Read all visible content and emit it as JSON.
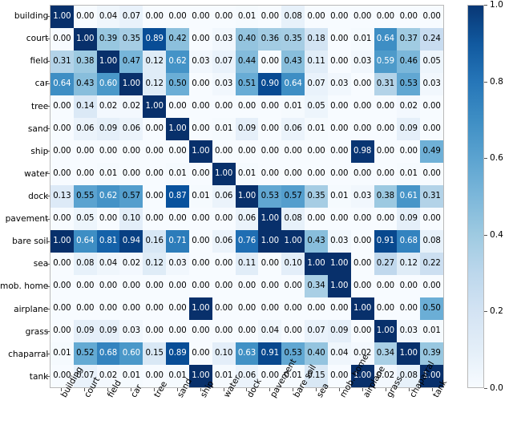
{
  "chart_data": {
    "type": "heatmap",
    "title": "",
    "xlabel": "",
    "ylabel": "",
    "colormap": "Blues",
    "colorbar": {
      "vmin": 0.0,
      "vmax": 1.0,
      "ticks": [
        0.0,
        0.2,
        0.4,
        0.6,
        0.8,
        1.0
      ],
      "tick_labels": [
        "0.0",
        "0.2",
        "0.4",
        "0.6",
        "0.8",
        "1.0"
      ],
      "position": "right"
    },
    "grid": false,
    "value_format": "0.00",
    "categories": [
      "building",
      "court",
      "field",
      "car",
      "tree",
      "sand",
      "ship",
      "water",
      "dock",
      "pavement",
      "bare soil",
      "sea",
      "mob. home",
      "airplane",
      "grass",
      "chaparral",
      "tank"
    ],
    "x_tick_labels": [
      "building",
      "court",
      "field",
      "car",
      "tree",
      "sand",
      "ship",
      "water",
      "dock",
      "pavement",
      "bare soil",
      "sea",
      "mob. home",
      "airplane",
      "grass",
      "chaparral",
      "tank"
    ],
    "y_tick_labels": [
      "building",
      "court",
      "field",
      "car",
      "tree",
      "sand",
      "ship",
      "water",
      "dock",
      "pavement",
      "bare soil",
      "sea",
      "mob. home",
      "airplane",
      "grass",
      "chaparral",
      "tank"
    ],
    "rows": [
      {
        "label": "building",
        "values": [
          1.0,
          0.0,
          0.04,
          0.07,
          0.0,
          0.0,
          0.0,
          0.0,
          0.01,
          0.0,
          0.08,
          0.0,
          0.0,
          0.0,
          0.0,
          0.0,
          0.0
        ]
      },
      {
        "label": "court",
        "values": [
          0.0,
          1.0,
          0.39,
          0.35,
          0.89,
          0.42,
          0.0,
          0.03,
          0.4,
          0.36,
          0.35,
          0.18,
          0.0,
          0.01,
          0.64,
          0.37,
          0.24
        ]
      },
      {
        "label": "field",
        "values": [
          0.31,
          0.38,
          1.0,
          0.47,
          0.12,
          0.62,
          0.03,
          0.07,
          0.44,
          0.0,
          0.43,
          0.11,
          0.0,
          0.03,
          0.59,
          0.46,
          0.05
        ]
      },
      {
        "label": "car",
        "values": [
          0.64,
          0.43,
          0.6,
          1.0,
          0.12,
          0.5,
          0.0,
          0.03,
          0.51,
          0.9,
          0.64,
          0.07,
          0.03,
          0.0,
          0.31,
          0.53,
          0.03
        ]
      },
      {
        "label": "tree",
        "values": [
          0.0,
          0.14,
          0.02,
          0.02,
          1.0,
          0.0,
          0.0,
          0.0,
          0.0,
          0.0,
          0.01,
          0.05,
          0.0,
          0.0,
          0.0,
          0.02,
          0.0
        ]
      },
      {
        "label": "sand",
        "values": [
          0.0,
          0.06,
          0.09,
          0.06,
          0.0,
          1.0,
          0.0,
          0.01,
          0.09,
          0.0,
          0.06,
          0.01,
          0.0,
          0.0,
          0.0,
          0.09,
          0.0
        ]
      },
      {
        "label": "ship",
        "values": [
          0.0,
          0.0,
          0.0,
          0.0,
          0.0,
          0.0,
          1.0,
          0.0,
          0.0,
          0.0,
          0.0,
          0.0,
          0.0,
          0.98,
          0.0,
          0.0,
          0.49
        ]
      },
      {
        "label": "water",
        "values": [
          0.0,
          0.0,
          0.01,
          0.0,
          0.0,
          0.01,
          0.0,
          1.0,
          0.01,
          0.0,
          0.0,
          0.0,
          0.0,
          0.0,
          0.0,
          0.01,
          0.0
        ]
      },
      {
        "label": "dock",
        "values": [
          0.13,
          0.55,
          0.62,
          0.57,
          0.0,
          0.87,
          0.01,
          0.06,
          1.0,
          0.53,
          0.57,
          0.35,
          0.01,
          0.03,
          0.38,
          0.61,
          0.31
        ]
      },
      {
        "label": "pavement",
        "values": [
          0.0,
          0.05,
          0.0,
          0.1,
          0.0,
          0.0,
          0.0,
          0.0,
          0.06,
          1.0,
          0.08,
          0.0,
          0.0,
          0.0,
          0.0,
          0.09,
          0.0
        ]
      },
      {
        "label": "bare soil",
        "values": [
          1.0,
          0.64,
          0.81,
          0.94,
          0.16,
          0.71,
          0.0,
          0.06,
          0.76,
          1.0,
          1.0,
          0.43,
          0.03,
          0.0,
          0.91,
          0.68,
          0.08
        ]
      },
      {
        "label": "sea",
        "values": [
          0.0,
          0.08,
          0.04,
          0.02,
          0.12,
          0.03,
          0.0,
          0.0,
          0.11,
          0.0,
          0.1,
          1.0,
          1.0,
          0.0,
          0.27,
          0.12,
          0.22
        ]
      },
      {
        "label": "mob. home",
        "values": [
          0.0,
          0.0,
          0.0,
          0.0,
          0.0,
          0.0,
          0.0,
          0.0,
          0.0,
          0.0,
          0.0,
          0.34,
          1.0,
          0.0,
          0.0,
          0.0,
          0.0
        ]
      },
      {
        "label": "airplane",
        "values": [
          0.0,
          0.0,
          0.0,
          0.0,
          0.0,
          0.0,
          1.0,
          0.0,
          0.0,
          0.0,
          0.0,
          0.0,
          0.0,
          1.0,
          0.0,
          0.0,
          0.5
        ]
      },
      {
        "label": "grass",
        "values": [
          0.0,
          0.09,
          0.09,
          0.03,
          0.0,
          0.0,
          0.0,
          0.0,
          0.0,
          0.04,
          0.0,
          0.07,
          0.09,
          0.0,
          1.0,
          0.03,
          0.01
        ]
      },
      {
        "label": "chaparral",
        "values": [
          0.01,
          0.52,
          0.68,
          0.6,
          0.15,
          0.89,
          0.0,
          0.1,
          0.63,
          0.91,
          0.53,
          0.4,
          0.04,
          0.02,
          0.34,
          1.0,
          0.39
        ]
      },
      {
        "label": "tank",
        "values": [
          0.0,
          0.07,
          0.02,
          0.01,
          0.0,
          0.01,
          1.0,
          0.01,
          0.06,
          0.0,
          0.01,
          0.15,
          0.0,
          1.0,
          0.02,
          0.08,
          1.0
        ]
      }
    ]
  }
}
